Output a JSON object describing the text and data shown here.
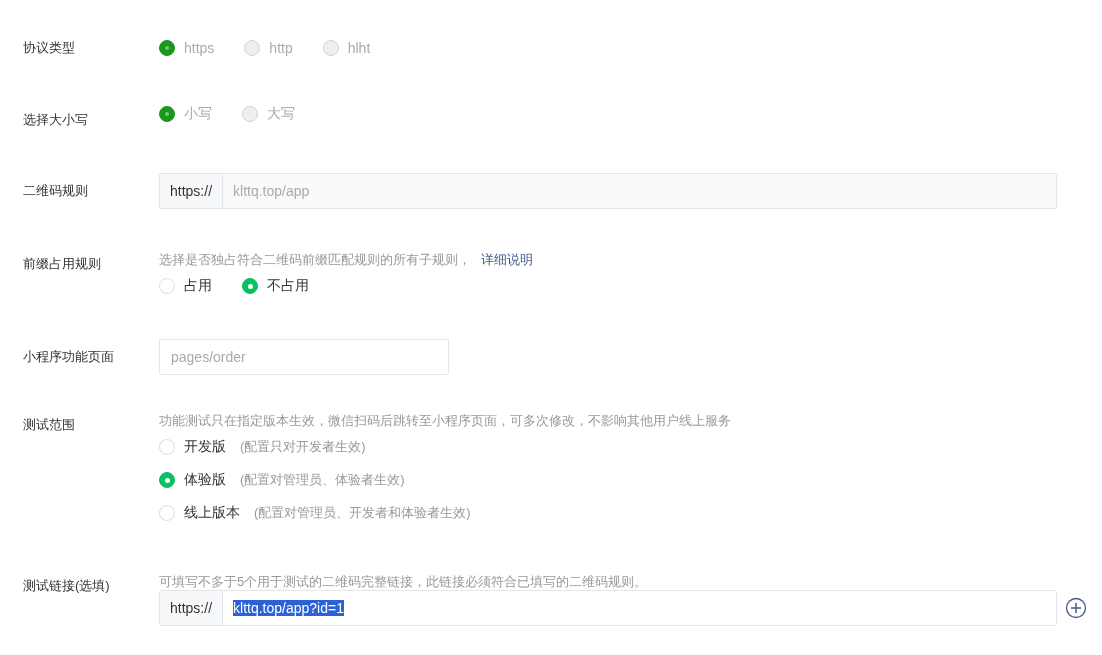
{
  "rows": [
    {
      "label": "协议类型",
      "kind": "radio",
      "disabled": true,
      "options": [
        {
          "label": "https",
          "selected": true
        },
        {
          "label": "http",
          "selected": false
        },
        {
          "label": "hlht",
          "selected": false
        }
      ]
    },
    {
      "label": "选择大小写",
      "kind": "radio",
      "disabled": true,
      "options": [
        {
          "label": "小写",
          "selected": true
        },
        {
          "label": "大写",
          "selected": false
        }
      ]
    },
    {
      "label": "二维码规则",
      "kind": "prefixed_input",
      "prefix": "https://",
      "placeholder": "klttq.top/app"
    },
    {
      "label": "前缀占用规则",
      "kind": "radio",
      "disabled": false,
      "description": "选择是否独占符合二维码前缀匹配规则的所有子规则，",
      "link": "详细说明",
      "options": [
        {
          "label": "占用",
          "selected": false
        },
        {
          "label": "不占用",
          "selected": true
        }
      ]
    },
    {
      "label": "小程序功能页面",
      "kind": "input",
      "placeholder": "pages/order"
    },
    {
      "label": "测试范围",
      "kind": "radio_list",
      "disabled": false,
      "description": "功能测试只在指定版本生效，微信扫码后跳转至小程序页面，可多次修改，不影响其他用户线上服务",
      "options": [
        {
          "label": "开发版",
          "note": "(配置只对开发者生效)",
          "selected": false
        },
        {
          "label": "体验版",
          "note": "(配置对管理员、体验者生效)",
          "selected": true
        },
        {
          "label": "线上版本",
          "note": "(配置对管理员、开发者和体验者生效)",
          "selected": false
        }
      ]
    },
    {
      "label": "测试链接(选填)",
      "kind": "prefixed_input",
      "description": "可填写不多于5个用于测试的二维码完整链接，此链接必须符合已填写的二维码规则。",
      "prefix": "https://",
      "value": "klttq.top/app?id=1",
      "text_selected": true,
      "add_button": true
    }
  ]
}
